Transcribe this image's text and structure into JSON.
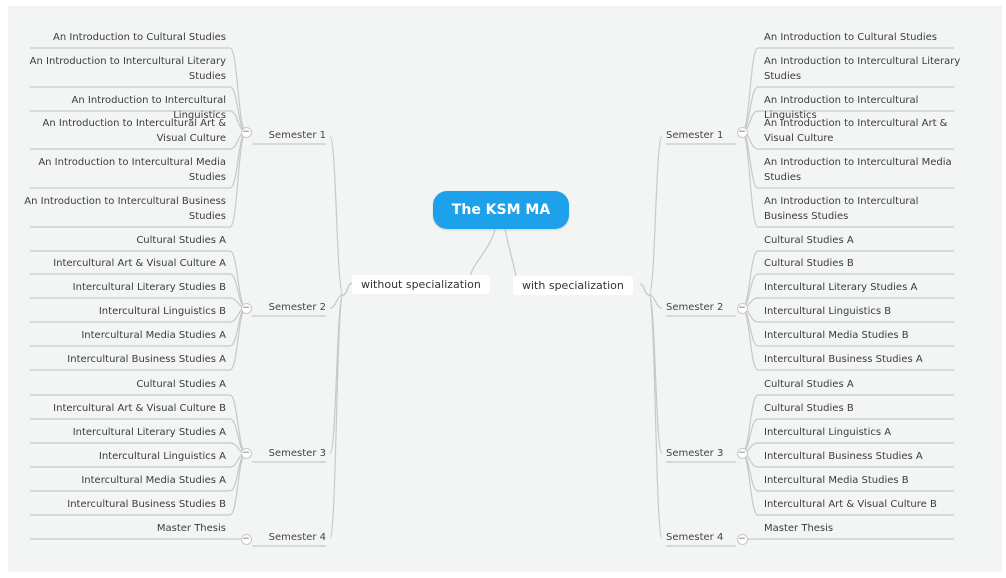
{
  "root": {
    "label": "The KSM MA"
  },
  "branches": {
    "without": {
      "label": "without specialization",
      "semesters": [
        {
          "label": "Semester 1",
          "courses": [
            "An Introduction to Cultural Studies",
            "An Introduction to Intercultural Literary Studies",
            "An Introduction to Intercultural Linguistics",
            "An Introduction to Intercultural Art & Visual Culture",
            "An Introduction to Intercultural Media Studies",
            "An Introduction to Intercultural Business Studies"
          ]
        },
        {
          "label": "Semester 2",
          "courses": [
            "Cultural Studies A",
            "Intercultural Art & Visual Culture A",
            "Intercultural Literary Studies B",
            "Intercultural Linguistics B",
            "Intercultural Media Studies A",
            "Intercultural Business Studies A"
          ]
        },
        {
          "label": "Semester 3",
          "courses": [
            "Cultural Studies A",
            "Intercultural Art & Visual Culture B",
            "Intercultural Literary Studies A",
            "Intercultural Linguistics A",
            "Intercultural Media Studies A",
            "Intercultural Business Studies B"
          ]
        },
        {
          "label": "Semester 4",
          "courses": [
            "Master Thesis"
          ]
        }
      ]
    },
    "with": {
      "label": "with specialization",
      "semesters": [
        {
          "label": "Semester 1",
          "courses": [
            "An Introduction to Cultural Studies",
            "An Introduction to Intercultural Literary Studies",
            "An Introduction to Intercultural Linguistics",
            "An Introduction to Intercultural Art & Visual Culture",
            "An Introduction to Intercultural Media Studies",
            "An Introduction to Intercultural Business Studies"
          ]
        },
        {
          "label": "Semester 2",
          "courses": [
            "Cultural Studies A",
            "Cultural Studies B",
            "Intercultural Literary Studies A",
            "Intercultural Linguistics B",
            "Intercultural Media Studies B",
            "Intercultural Business Studies A"
          ]
        },
        {
          "label": "Semester 3",
          "courses": [
            "Cultural Studies A",
            "Cultural Studies B",
            "Intercultural Linguistics A",
            "Intercultural Business Studies A",
            "Intercultural Media Studies B",
            "Intercultural Art & Visual Culture B"
          ]
        },
        {
          "label": "Semester 4",
          "courses": [
            "Master Thesis"
          ]
        }
      ]
    }
  },
  "collapse_symbol": "−",
  "colors": {
    "root": "#1da1ea",
    "line": "#c6c9cb",
    "background": "#f3f4f4"
  }
}
